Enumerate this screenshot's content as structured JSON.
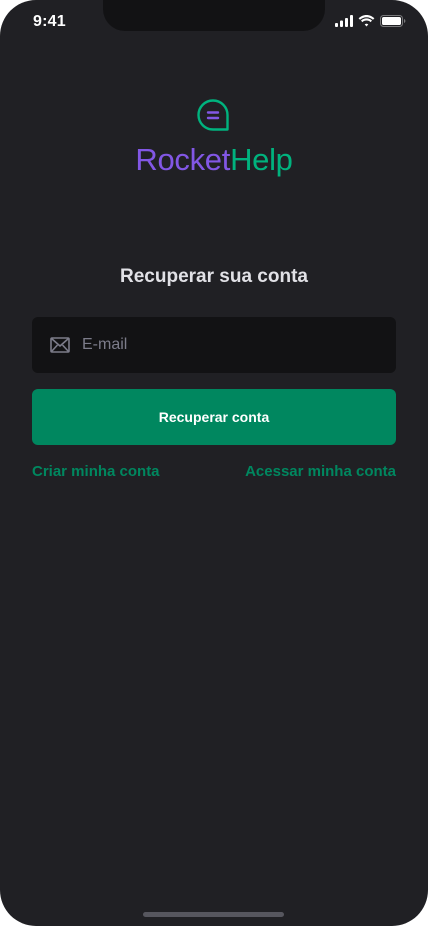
{
  "status_bar": {
    "time": "9:41",
    "icons": [
      "cellular-signal-icon",
      "wifi-icon",
      "battery-icon"
    ]
  },
  "brand": {
    "name_part1": "Rocket",
    "name_part2": "Help",
    "logo_icon": "chat-bubble-icon",
    "colors": {
      "purple": "#8257e5",
      "green": "#00b37e"
    }
  },
  "screen": {
    "title": "Recuperar sua conta"
  },
  "form": {
    "email": {
      "placeholder": "E-mail",
      "value": "",
      "icon": "envelope-icon"
    },
    "submit_label": "Recuperar conta"
  },
  "links": {
    "create_account": "Criar minha conta",
    "access_account": "Acessar minha conta"
  },
  "theme": {
    "background": "#202024",
    "input_background": "#121214",
    "primary": "#00875f",
    "text": "#e1e1e6",
    "placeholder": "#7c7c8a"
  }
}
